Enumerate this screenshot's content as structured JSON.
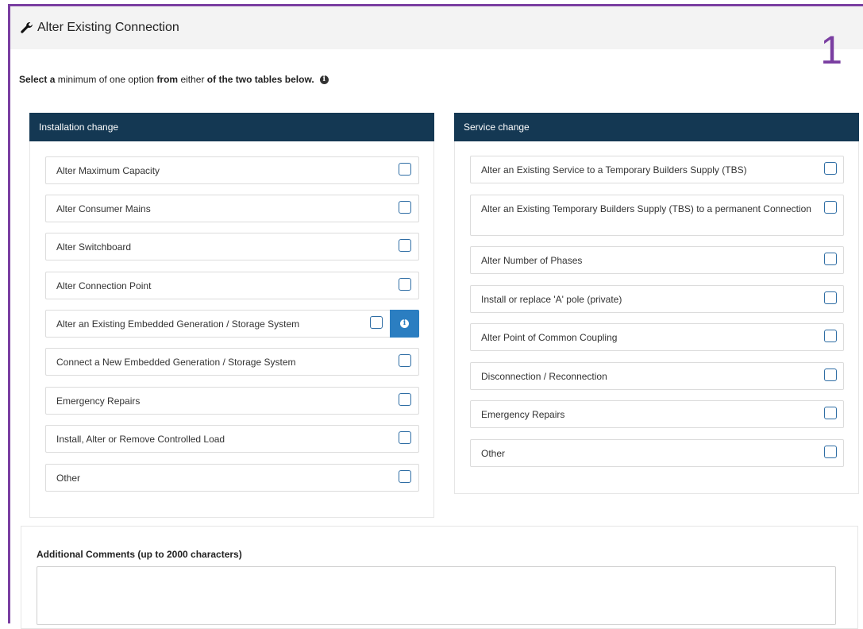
{
  "header": {
    "title": "Alter Existing Connection",
    "step": "1"
  },
  "instruction": {
    "part1": "Select a",
    "part2": " minimum of one option ",
    "part3": "from",
    "part4": " either ",
    "part5": "of the two tables below."
  },
  "installation": {
    "title": "Installation change",
    "options": [
      {
        "label": "Alter Maximum Capacity",
        "checked": false
      },
      {
        "label": "Alter Consumer Mains",
        "checked": false
      },
      {
        "label": "Alter Switchboard",
        "checked": false
      },
      {
        "label": "Alter Connection Point",
        "checked": false
      },
      {
        "label": "Alter an Existing Embedded Generation / Storage System",
        "checked": false
      },
      {
        "label": "Connect a New Embedded Generation / Storage System",
        "checked": false
      },
      {
        "label": "Emergency Repairs",
        "checked": false
      },
      {
        "label": "Install, Alter or Remove Controlled Load",
        "checked": false
      },
      {
        "label": "Other",
        "checked": false
      }
    ]
  },
  "service": {
    "title": "Service change",
    "options": [
      {
        "label": "Alter an Existing Service to a Temporary Builders Supply (TBS)",
        "checked": false
      },
      {
        "label": "Alter an Existing Temporary Builders Supply (TBS) to a permanent Connection",
        "checked": false
      },
      {
        "label": "Alter Number of Phases",
        "checked": false
      },
      {
        "label": "Install or replace 'A' pole (private)",
        "checked": false
      },
      {
        "label": "Alter Point of Common Coupling",
        "checked": false
      },
      {
        "label": "Disconnection / Reconnection",
        "checked": false
      },
      {
        "label": "Emergency Repairs",
        "checked": false
      },
      {
        "label": "Other",
        "checked": false
      }
    ]
  },
  "comments": {
    "label": "Additional Comments (up to 2000 characters)",
    "value": ""
  },
  "colors": {
    "panel_header": "#143853",
    "accent": "#2b7ec1",
    "frame": "#7a3ea1"
  }
}
